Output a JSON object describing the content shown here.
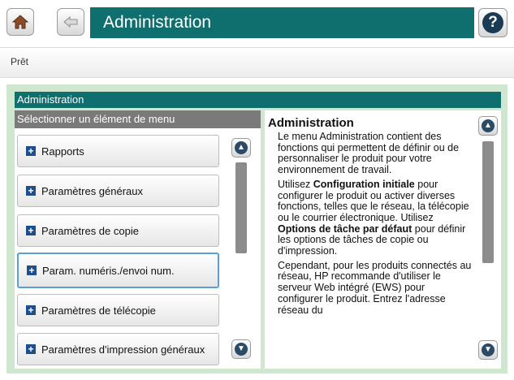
{
  "header": {
    "title": "Administration",
    "help_glyph": "?"
  },
  "status": {
    "text": "Prêt"
  },
  "panel": {
    "title": "Administration",
    "menu_header": "Sélectionner un élément de menu",
    "items": [
      {
        "label": "Rapports"
      },
      {
        "label": "Paramètres généraux"
      },
      {
        "label": "Paramètres de copie"
      },
      {
        "label": "Param. numéris./envoi num."
      },
      {
        "label": "Paramètres de télécopie"
      },
      {
        "label": "Paramètres d'impression généraux"
      }
    ],
    "selected_index": 3
  },
  "help": {
    "title": "Administration",
    "p1": "Le menu Administration contient des fonctions qui permettent de définir ou de personnaliser le produit pour votre environnement de travail.",
    "p2_a": "Utilisez ",
    "p2_b": "Configuration initiale",
    "p2_c": " pour configurer le produit ou activer diverses fonctions, telles que le réseau, la télécopie ou le courrier électronique. Utilisez ",
    "p2_d": "Options de tâche par défaut",
    "p2_e": " pour définir les options de tâches de copie ou d'impression.",
    "p3": "Cependant, pour les produits connectés au réseau, HP recommande d'utiliser le serveur Web intégré (EWS) pour configurer le produit. Entrez l'adresse réseau du"
  },
  "colors": {
    "accent": "#0f6e6e",
    "panel_bg": "#cfe6cf",
    "selected_border": "#5aa0d8"
  }
}
